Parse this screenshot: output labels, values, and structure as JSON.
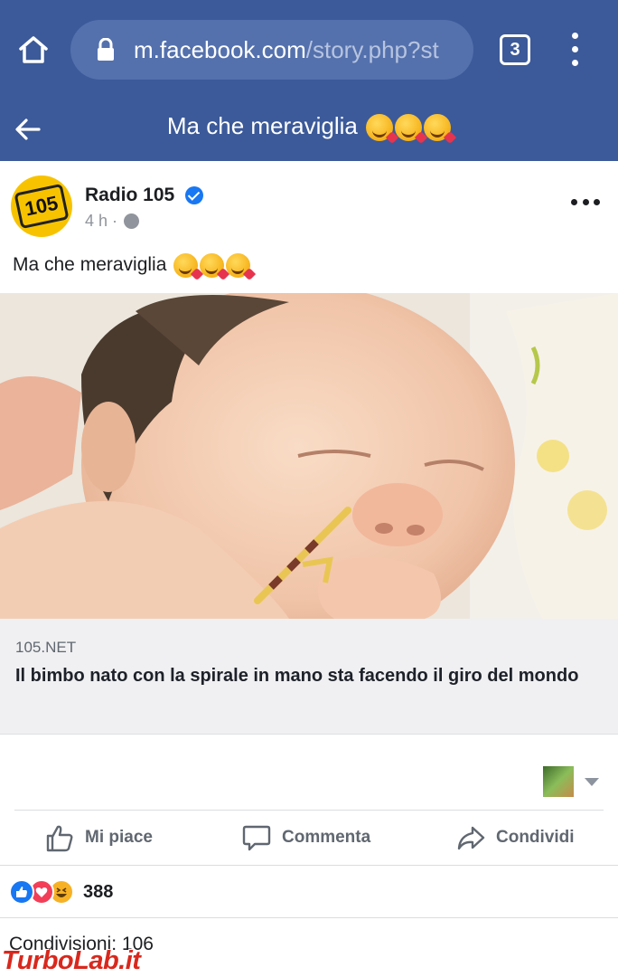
{
  "browser": {
    "url_host": "m.facebook.com",
    "url_path": "/story.php?st",
    "tab_count": "3"
  },
  "header": {
    "title": "Ma che meraviglia"
  },
  "post": {
    "page_name": "Radio 105",
    "avatar_text": "105",
    "time": "4 h ·",
    "text": "Ma che meraviglia",
    "link": {
      "domain": "105.NET",
      "title": "Il bimbo nato con la spirale in mano sta facendo il giro del mondo"
    }
  },
  "actions": {
    "like": "Mi piace",
    "comment": "Commenta",
    "share": "Condividi"
  },
  "reactions": {
    "count": "388",
    "icons": [
      "like-icon",
      "love-icon",
      "haha-icon"
    ]
  },
  "shares_text": "Condivisioni: 106",
  "watermark": "TurboLab.it",
  "colors": {
    "facebook_blue": "#3c5a99",
    "like": "#1877f2",
    "love": "#f33e58",
    "haha": "#f7b125"
  }
}
